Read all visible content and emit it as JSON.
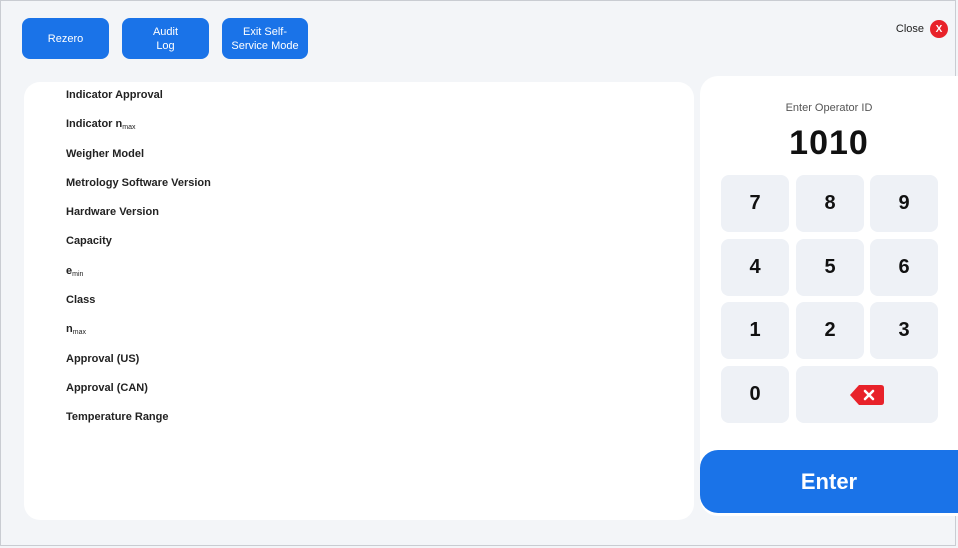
{
  "toolbar": {
    "rezero_label": "Rezero",
    "audit_label_line1": "Audit",
    "audit_label_line2": "Log",
    "exit_label_line1": "Exit Self-",
    "exit_label_line2": "Service Mode"
  },
  "close": {
    "label": "Close",
    "icon_text": "X"
  },
  "info": {
    "items": [
      {
        "label": "Indicator Approval"
      },
      {
        "label": "Indicator n",
        "sub": "max"
      },
      {
        "label": "Weigher Model"
      },
      {
        "label": "Metrology Software Version"
      },
      {
        "label": "Hardware Version"
      },
      {
        "label": "Capacity"
      },
      {
        "label": "e",
        "sub": "min"
      },
      {
        "label": "Class"
      },
      {
        "label": "n",
        "sub": "max"
      },
      {
        "label": "Approval (US)"
      },
      {
        "label": "Approval (CAN)"
      },
      {
        "label": "Temperature Range"
      }
    ]
  },
  "keypad": {
    "prompt": "Enter Operator ID",
    "value": "1010",
    "keys": [
      "7",
      "8",
      "9",
      "4",
      "5",
      "6",
      "1",
      "2",
      "3",
      "0"
    ],
    "backspace_icon": "backspace-icon",
    "enter_label": "Enter"
  },
  "colors": {
    "accent": "#1a73e8",
    "close_red": "#e8222a",
    "backspace_red": "#e8222a"
  }
}
